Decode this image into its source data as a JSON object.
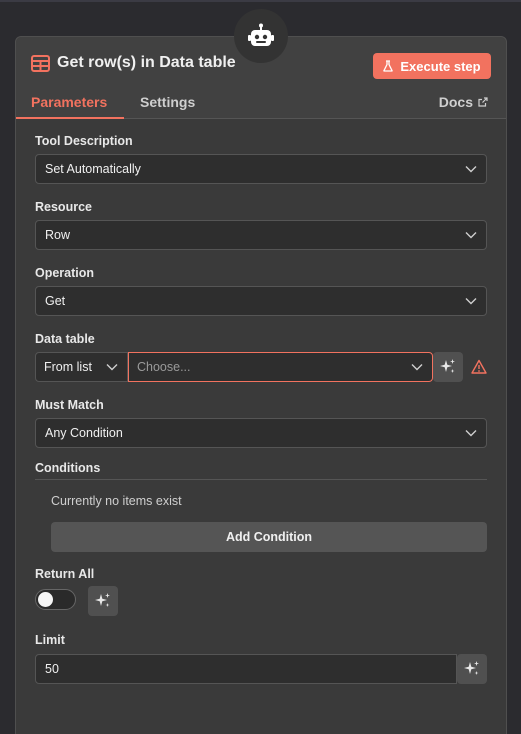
{
  "node": {
    "title": "Get row(s) in Data table",
    "execute_label": "Execute step",
    "node_icon": "robot-icon",
    "title_icon": "table-icon"
  },
  "tabs": {
    "parameters": "Parameters",
    "settings": "Settings",
    "docs": "Docs"
  },
  "fields": {
    "tool_description": {
      "label": "Tool Description",
      "value": "Set Automatically"
    },
    "resource": {
      "label": "Resource",
      "value": "Row"
    },
    "operation": {
      "label": "Operation",
      "value": "Get"
    },
    "data_table": {
      "label": "Data table",
      "mode": "From list",
      "placeholder": "Choose..."
    },
    "must_match": {
      "label": "Must Match",
      "value": "Any Condition"
    },
    "conditions": {
      "label": "Conditions",
      "empty_text": "Currently no items exist",
      "add_label": "Add Condition"
    },
    "return_all": {
      "label": "Return All"
    },
    "limit": {
      "label": "Limit",
      "value": "50"
    }
  },
  "colors": {
    "accent": "#f2725f",
    "panel": "#414141",
    "field_bg": "#2e2e2e"
  }
}
